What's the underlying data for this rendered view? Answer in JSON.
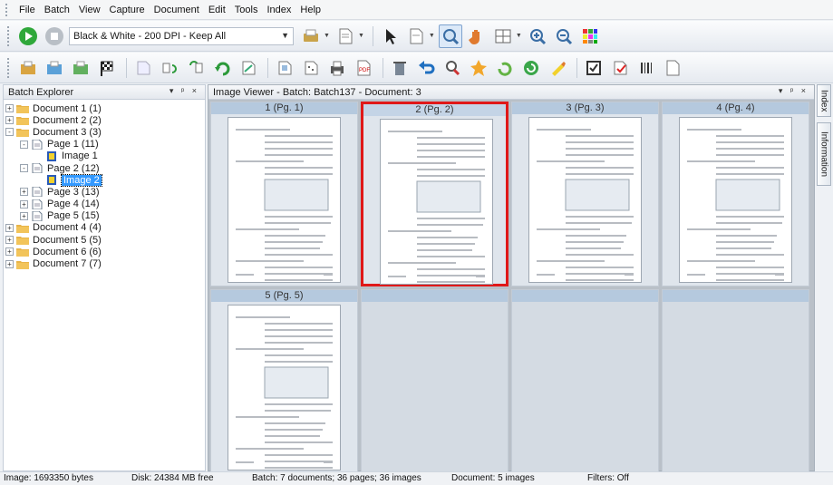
{
  "menu": [
    "File",
    "Batch",
    "View",
    "Capture",
    "Document",
    "Edit",
    "Tools",
    "Index",
    "Help"
  ],
  "toolbar": {
    "profile": "Black & White - 200 DPI - Keep All",
    "icons1": [
      "play-icon",
      "stop-icon"
    ],
    "icons1b": [
      "scan-icon",
      "page-icon",
      "pointer-icon",
      "page-options-icon",
      "zoom-area-icon",
      "pan-hand-icon",
      "thumbnail-grid-icon",
      "zoom-in-icon",
      "zoom-out-icon",
      "color-grid-icon"
    ],
    "icons2": [
      "import-icon",
      "import-batch-icon",
      "export-icon",
      "finish-flag-icon",
      "blank-page-icon",
      "split-icon",
      "merge-icon",
      "rotate-icon",
      "deskew-icon",
      "crop-icon",
      "despeckle-icon",
      "print-icon",
      "pdf-icon",
      "delete-icon",
      "undo-icon",
      "find-icon",
      "bookmark-icon",
      "refresh-icon",
      "process-icon",
      "highlight-icon",
      "checkbox-icon",
      "red-check-icon",
      "barcode-icon",
      "document-icon"
    ]
  },
  "batch_explorer": {
    "title": "Batch Explorer",
    "controls": "▾ ᵖ ×",
    "tree": [
      {
        "label": "Document 1 (1)",
        "level": 0,
        "kind": "folder",
        "expander": "+"
      },
      {
        "label": "Document 2 (2)",
        "level": 0,
        "kind": "folder",
        "expander": "+"
      },
      {
        "label": "Document 3 (3)",
        "level": 0,
        "kind": "folder",
        "expander": "-"
      },
      {
        "label": "Page 1 (11)",
        "level": 1,
        "kind": "page",
        "expander": "-"
      },
      {
        "label": "Image 1",
        "level": 2,
        "kind": "image",
        "expander": ""
      },
      {
        "label": "Page 2 (12)",
        "level": 1,
        "kind": "page",
        "expander": "-"
      },
      {
        "label": "Image 2",
        "level": 2,
        "kind": "image",
        "expander": "",
        "selected": true
      },
      {
        "label": "Page 3 (13)",
        "level": 1,
        "kind": "page",
        "expander": "+"
      },
      {
        "label": "Page 4 (14)",
        "level": 1,
        "kind": "page",
        "expander": "+"
      },
      {
        "label": "Page 5 (15)",
        "level": 1,
        "kind": "page",
        "expander": "+"
      },
      {
        "label": "Document 4 (4)",
        "level": 0,
        "kind": "folder",
        "expander": "+"
      },
      {
        "label": "Document 5 (5)",
        "level": 0,
        "kind": "folder",
        "expander": "+"
      },
      {
        "label": "Document 6 (6)",
        "level": 0,
        "kind": "folder",
        "expander": "+"
      },
      {
        "label": "Document 7 (7)",
        "level": 0,
        "kind": "folder",
        "expander": "+"
      }
    ]
  },
  "viewer": {
    "title": "Image Viewer - Batch: Batch137 - Document: 3",
    "controls": "▾ ᵖ ×",
    "pages": [
      {
        "label": "1 (Pg. 1)",
        "selected": false
      },
      {
        "label": "2 (Pg. 2)",
        "selected": true
      },
      {
        "label": "3 (Pg. 3)",
        "selected": false
      },
      {
        "label": "4 (Pg. 4)",
        "selected": false
      },
      {
        "label": "5 (Pg. 5)",
        "selected": false
      }
    ]
  },
  "side_tabs": [
    "Index",
    "Information"
  ],
  "status": {
    "image": "Image: 1693350 bytes",
    "disk": "Disk: 24384 MB free",
    "batch": "Batch: 7 documents; 36 pages; 36 images",
    "document": "Document: 5 images",
    "filters": "Filters: Off"
  },
  "colors": {
    "selection": "#e01818",
    "tree_highlight": "#3399ff",
    "header_blue": "#b5c9de"
  }
}
